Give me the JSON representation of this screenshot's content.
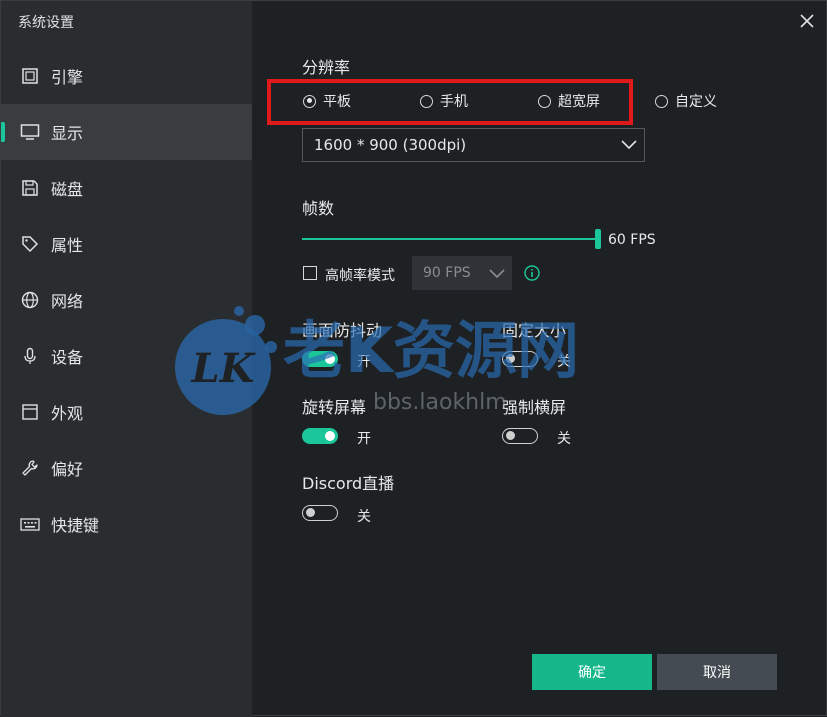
{
  "window": {
    "title": "系统设置"
  },
  "sidebar": {
    "active_index": 1,
    "items": [
      {
        "label": "引擎",
        "icon": "chip-icon"
      },
      {
        "label": "显示",
        "icon": "monitor-icon"
      },
      {
        "label": "磁盘",
        "icon": "floppy-icon"
      },
      {
        "label": "属性",
        "icon": "tag-icon"
      },
      {
        "label": "网络",
        "icon": "globe-icon"
      },
      {
        "label": "设备",
        "icon": "microphone-icon"
      },
      {
        "label": "外观",
        "icon": "window-icon"
      },
      {
        "label": "偏好",
        "icon": "wrench-icon"
      },
      {
        "label": "快捷键",
        "icon": "keyboard-icon"
      }
    ]
  },
  "resolution": {
    "title": "分辨率",
    "options": [
      {
        "label": "平板",
        "checked": true
      },
      {
        "label": "手机",
        "checked": false
      },
      {
        "label": "超宽屏",
        "checked": false
      },
      {
        "label": "自定义",
        "checked": false
      }
    ],
    "selected_value": "1600 * 900 (300dpi)"
  },
  "fps": {
    "title": "帧数",
    "value_label": "60 FPS",
    "slider_fraction": 1.0,
    "high_fps_label": "高帧率模式",
    "high_fps_checked": false,
    "high_fps_select": "90 FPS"
  },
  "options": {
    "screen_shake": {
      "label": "画面防抖动",
      "state_label": "开",
      "on": true
    },
    "fixed_size": {
      "label": "固定大小",
      "state_label": "关",
      "on": false
    },
    "rotate_screen": {
      "label": "旋转屏幕",
      "state_label": "开",
      "on": true
    },
    "force_landscape": {
      "label": "强制横屏",
      "state_label": "关",
      "on": false
    },
    "discord": {
      "label": "Discord直播",
      "state_label": "关",
      "on": false
    }
  },
  "footer": {
    "ok_label": "确定",
    "cancel_label": "取消"
  },
  "watermark": {
    "logo_text": "LK",
    "brand_text": "老K资源网",
    "url_text": "bbs.laokhlm"
  },
  "colors": {
    "accent": "#1bc79a",
    "highlight": "#e01a1a",
    "sidebar_bg": "#2a2d30",
    "main_bg": "#1e2124"
  }
}
